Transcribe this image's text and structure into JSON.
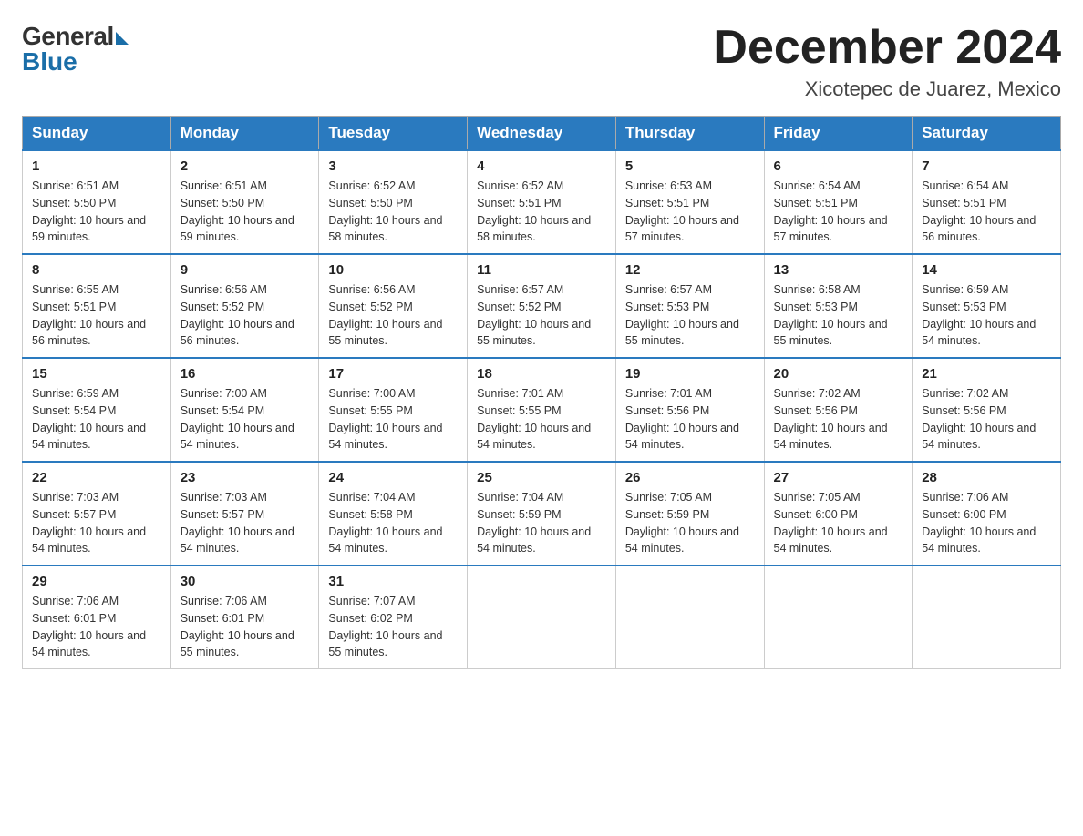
{
  "logo": {
    "general": "General",
    "blue": "Blue"
  },
  "title": "December 2024",
  "location": "Xicotepec de Juarez, Mexico",
  "days_of_week": [
    "Sunday",
    "Monday",
    "Tuesday",
    "Wednesday",
    "Thursday",
    "Friday",
    "Saturday"
  ],
  "weeks": [
    [
      {
        "day": "1",
        "sunrise": "6:51 AM",
        "sunset": "5:50 PM",
        "daylight": "10 hours and 59 minutes."
      },
      {
        "day": "2",
        "sunrise": "6:51 AM",
        "sunset": "5:50 PM",
        "daylight": "10 hours and 59 minutes."
      },
      {
        "day": "3",
        "sunrise": "6:52 AM",
        "sunset": "5:50 PM",
        "daylight": "10 hours and 58 minutes."
      },
      {
        "day": "4",
        "sunrise": "6:52 AM",
        "sunset": "5:51 PM",
        "daylight": "10 hours and 58 minutes."
      },
      {
        "day": "5",
        "sunrise": "6:53 AM",
        "sunset": "5:51 PM",
        "daylight": "10 hours and 57 minutes."
      },
      {
        "day": "6",
        "sunrise": "6:54 AM",
        "sunset": "5:51 PM",
        "daylight": "10 hours and 57 minutes."
      },
      {
        "day": "7",
        "sunrise": "6:54 AM",
        "sunset": "5:51 PM",
        "daylight": "10 hours and 56 minutes."
      }
    ],
    [
      {
        "day": "8",
        "sunrise": "6:55 AM",
        "sunset": "5:51 PM",
        "daylight": "10 hours and 56 minutes."
      },
      {
        "day": "9",
        "sunrise": "6:56 AM",
        "sunset": "5:52 PM",
        "daylight": "10 hours and 56 minutes."
      },
      {
        "day": "10",
        "sunrise": "6:56 AM",
        "sunset": "5:52 PM",
        "daylight": "10 hours and 55 minutes."
      },
      {
        "day": "11",
        "sunrise": "6:57 AM",
        "sunset": "5:52 PM",
        "daylight": "10 hours and 55 minutes."
      },
      {
        "day": "12",
        "sunrise": "6:57 AM",
        "sunset": "5:53 PM",
        "daylight": "10 hours and 55 minutes."
      },
      {
        "day": "13",
        "sunrise": "6:58 AM",
        "sunset": "5:53 PM",
        "daylight": "10 hours and 55 minutes."
      },
      {
        "day": "14",
        "sunrise": "6:59 AM",
        "sunset": "5:53 PM",
        "daylight": "10 hours and 54 minutes."
      }
    ],
    [
      {
        "day": "15",
        "sunrise": "6:59 AM",
        "sunset": "5:54 PM",
        "daylight": "10 hours and 54 minutes."
      },
      {
        "day": "16",
        "sunrise": "7:00 AM",
        "sunset": "5:54 PM",
        "daylight": "10 hours and 54 minutes."
      },
      {
        "day": "17",
        "sunrise": "7:00 AM",
        "sunset": "5:55 PM",
        "daylight": "10 hours and 54 minutes."
      },
      {
        "day": "18",
        "sunrise": "7:01 AM",
        "sunset": "5:55 PM",
        "daylight": "10 hours and 54 minutes."
      },
      {
        "day": "19",
        "sunrise": "7:01 AM",
        "sunset": "5:56 PM",
        "daylight": "10 hours and 54 minutes."
      },
      {
        "day": "20",
        "sunrise": "7:02 AM",
        "sunset": "5:56 PM",
        "daylight": "10 hours and 54 minutes."
      },
      {
        "day": "21",
        "sunrise": "7:02 AM",
        "sunset": "5:56 PM",
        "daylight": "10 hours and 54 minutes."
      }
    ],
    [
      {
        "day": "22",
        "sunrise": "7:03 AM",
        "sunset": "5:57 PM",
        "daylight": "10 hours and 54 minutes."
      },
      {
        "day": "23",
        "sunrise": "7:03 AM",
        "sunset": "5:57 PM",
        "daylight": "10 hours and 54 minutes."
      },
      {
        "day": "24",
        "sunrise": "7:04 AM",
        "sunset": "5:58 PM",
        "daylight": "10 hours and 54 minutes."
      },
      {
        "day": "25",
        "sunrise": "7:04 AM",
        "sunset": "5:59 PM",
        "daylight": "10 hours and 54 minutes."
      },
      {
        "day": "26",
        "sunrise": "7:05 AM",
        "sunset": "5:59 PM",
        "daylight": "10 hours and 54 minutes."
      },
      {
        "day": "27",
        "sunrise": "7:05 AM",
        "sunset": "6:00 PM",
        "daylight": "10 hours and 54 minutes."
      },
      {
        "day": "28",
        "sunrise": "7:06 AM",
        "sunset": "6:00 PM",
        "daylight": "10 hours and 54 minutes."
      }
    ],
    [
      {
        "day": "29",
        "sunrise": "7:06 AM",
        "sunset": "6:01 PM",
        "daylight": "10 hours and 54 minutes."
      },
      {
        "day": "30",
        "sunrise": "7:06 AM",
        "sunset": "6:01 PM",
        "daylight": "10 hours and 55 minutes."
      },
      {
        "day": "31",
        "sunrise": "7:07 AM",
        "sunset": "6:02 PM",
        "daylight": "10 hours and 55 minutes."
      },
      null,
      null,
      null,
      null
    ]
  ]
}
